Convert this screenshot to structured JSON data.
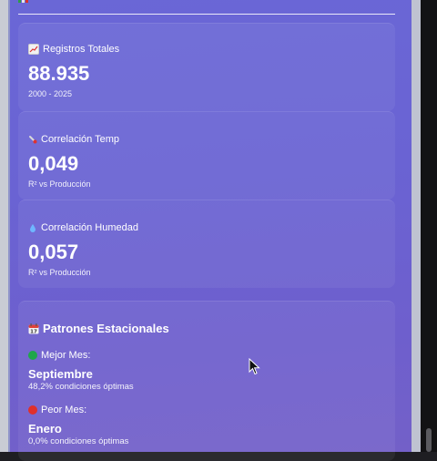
{
  "colors": {
    "panel_gradient_start": "#6a67d6",
    "panel_gradient_end": "#7360c8",
    "text": "#ffffff",
    "best_month_dot": "#1fa64a",
    "worst_month_dot": "#e0302b"
  },
  "cards": [
    {
      "icon": "chart-emoji-icon",
      "label": "Registros Totales",
      "value": "88.935",
      "sub": "2000 - 2025"
    },
    {
      "icon": "thermometer-emoji-icon",
      "label": "Correlación Temp",
      "value": "0,049",
      "sub": "R² vs Producción"
    },
    {
      "icon": "droplet-emoji-icon",
      "label": "Correlación Humedad",
      "value": "0,057",
      "sub": "R² vs Producción"
    }
  ],
  "patterns": {
    "icon": "calendar-emoji-icon",
    "title": "Patrones Estacionales",
    "best": {
      "icon": "green-circle-icon",
      "label": "Mejor Mes:",
      "month": "Septiembre",
      "detail": "48,2% condiciones óptimas"
    },
    "worst": {
      "icon": "red-circle-icon",
      "label": "Peor Mes:",
      "month": "Enero",
      "detail": "0,0% condiciones óptimas"
    }
  }
}
